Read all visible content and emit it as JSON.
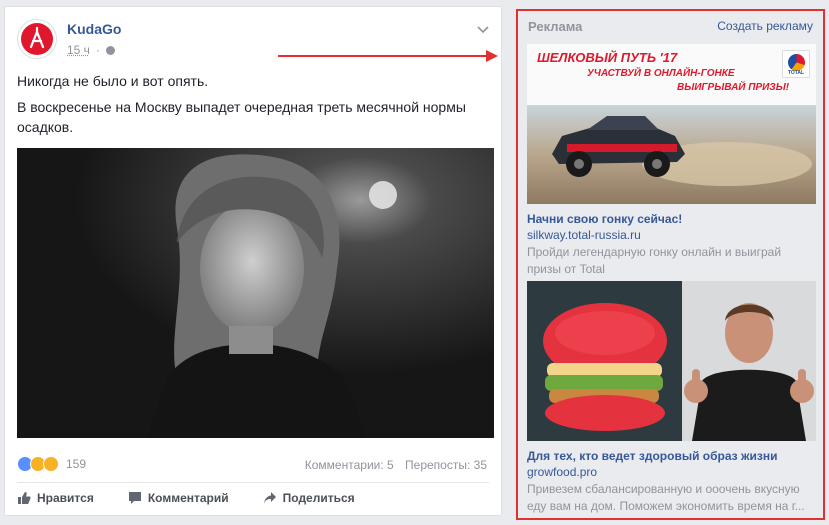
{
  "post": {
    "author": "KudaGo",
    "time": "15 ч",
    "text_lines": [
      "Никогда не было и вот опять.",
      "В воскресенье на Москву выпадет очередная треть месячной нормы осадков."
    ],
    "reaction_count": "159",
    "comments": "Комментарии: 5",
    "shares": "Перепосты: 35",
    "actions": {
      "like": "Нравится",
      "comment": "Комментарий",
      "share": "Поделиться"
    }
  },
  "ads": {
    "title": "Реклама",
    "create_link": "Создать рекламу",
    "items": [
      {
        "banner_line1": "ШЕЛКОВЫЙ ПУТЬ '17",
        "banner_line2": "УЧАСТВУЙ В ОНЛАЙН-ГОНКЕ",
        "banner_line3": "ВЫИГРЫВАЙ ПРИЗЫ!",
        "logo_text": "TOTAL",
        "headline": "Начни свою гонку сейчас!",
        "domain": "silkway.total-russia.ru",
        "description": "Пройди легендарную гонку онлайн и выиграй призы от Total"
      },
      {
        "headline": "Для тех, кто ведет здоровый образ жизни",
        "domain": "growfood.pro",
        "description": "Привезем сбалансированную и ооочень вкусную еду вам на дом. Поможем экономить время на г..."
      }
    ]
  },
  "colors": {
    "link": "#365899",
    "muted": "#90949c",
    "highlight_border": "#e03030",
    "brand_red": "#e0182d"
  }
}
